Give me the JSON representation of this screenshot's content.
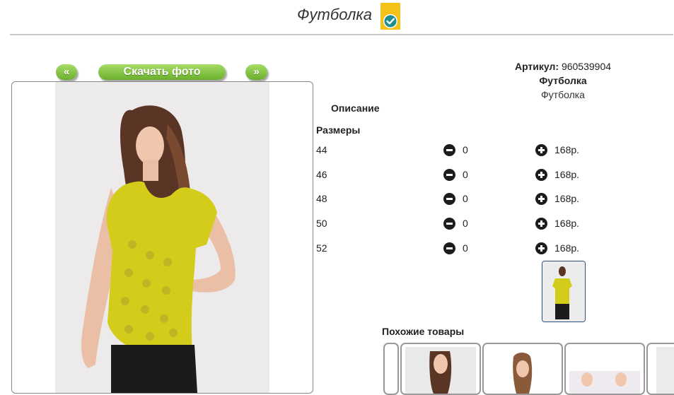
{
  "header": {
    "title": "Футболка",
    "badge_icon": "check-badge-icon",
    "badge_color": "#f5c21a",
    "check_color": "#1e8f8f"
  },
  "gallery": {
    "prev_label": "«",
    "download_label": "Скачать фото",
    "next_label": "»",
    "button_color": "#7cc13a"
  },
  "product": {
    "article_label": "Артикул:",
    "article_value": "960539904",
    "name": "Футболка",
    "subtitle": "Футболка",
    "description_label": "Описание",
    "sizes_label": "Размеры",
    "sizes": [
      {
        "size": "44",
        "qty": "0",
        "price": "168р."
      },
      {
        "size": "46",
        "qty": "0",
        "price": "168р."
      },
      {
        "size": "48",
        "qty": "0",
        "price": "168р."
      },
      {
        "size": "50",
        "qty": "0",
        "price": "168р."
      },
      {
        "size": "52",
        "qty": "0",
        "price": "168р."
      }
    ],
    "shirt_color": "#d4cc1a"
  },
  "similar": {
    "label": "Похожие товары"
  }
}
